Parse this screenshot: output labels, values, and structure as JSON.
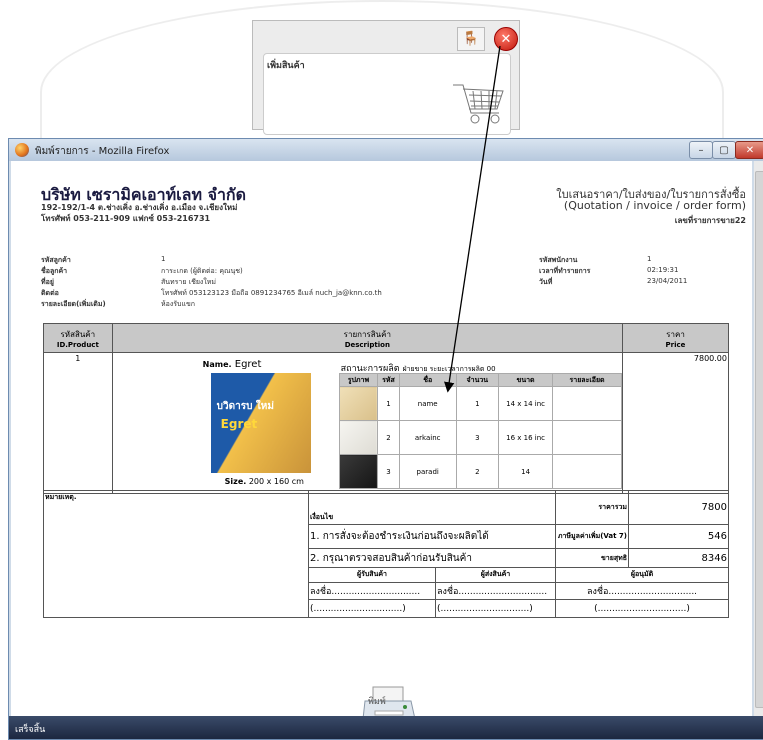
{
  "popup": {
    "title": "เพิ่มสินค้า",
    "close_label": "✕"
  },
  "window": {
    "title": "พิมพ์รายการ - Mozilla Firefox",
    "status": "เสร็จสิ้น",
    "min_label": "–",
    "max_label": "▢",
    "close_label": "✕"
  },
  "company": {
    "name": "บริษัท เซรามิคเอาท์เลท จำกัด",
    "address": "192-192/1-4 ต.ช่างเคิ่ง อ.ช่างเคิ่ง อ.เมือง จ.เชียงใหม่",
    "tel": "โทรศัพท์ 053-211-909 แฟกซ์ 053-216731"
  },
  "document": {
    "title": "ใบเสนอราคา/ใบส่งของ/ใบรายการสั่งซื้อ",
    "subtitle": "(Quotation / invoice / order form)",
    "number_label": "เลขที่รายการขาย22"
  },
  "customer": [
    {
      "label": "รหัสลูกค้า",
      "value": "1"
    },
    {
      "label": "ชื่อลูกค้า",
      "value": "การะเกด (ผู้ติดต่อ: คุณนุช)"
    },
    {
      "label": "ที่อยู่",
      "value": "สันทราย เชียงใหม่"
    },
    {
      "label": "ติดต่อ",
      "value": "โทรศัพท์  053123123  มือถือ  0891234765  อีเมล์  nuch_ja@knn.co.th"
    },
    {
      "label": "รายละเอียด(เพิ่มเติม)",
      "value": "ห้องรับแขก"
    }
  ],
  "order_info": [
    {
      "label": "รหัสพนักงาน",
      "value": "1"
    },
    {
      "label": "เวลาที่ทำรายการ",
      "value": "02:19:31"
    },
    {
      "label": "วันที่",
      "value": "23/04/2011"
    }
  ],
  "table_header": {
    "id_th": "รหัสสินค้า",
    "id_en": "ID.Product",
    "desc_th": "รายการสินค้า",
    "desc_en": "Description",
    "price_th": "ราคา",
    "price_en": "Price"
  },
  "product": {
    "id": "1",
    "name_label": "Name.",
    "name": "Egret",
    "img_text1": "บวิดารบ ใหม่",
    "img_text2": "Egret",
    "size_label": "Size.",
    "size": "200 x 160 cm",
    "status": "สถานะการผลิต",
    "status_detail": "ฝ่ายขาย ระยะเวลาการผลิต 00",
    "price": "7800.00"
  },
  "pattern_headers": [
    "รูปภาพ",
    "รหัส",
    "ชื่อ",
    "จำนวน",
    "ขนาด",
    "รายละเอียด"
  ],
  "patterns": [
    {
      "code": "1",
      "name": "name",
      "qty": "1",
      "size": "14 x 14 inc",
      "detail": "",
      "color": "#e6d3a6"
    },
    {
      "code": "2",
      "name": "arkainc",
      "qty": "3",
      "size": "16 x 16 inc",
      "detail": "",
      "color": "#ecebe6"
    },
    {
      "code": "3",
      "name": "paradi",
      "qty": "2",
      "size": "14",
      "detail": "",
      "color": "#2a2a2a"
    }
  ],
  "footer": {
    "note_label": "หมายเหตุ.",
    "cond_label": "เงื่อนไข",
    "cond1": "1. การสั่งจะต้องชำระเงินก่อนถึงจะผลิตได้",
    "cond2": "2. กรุณาตรวจสอบสินค้าก่อนรับสินค้า",
    "subtotal_label": "ราคารวม",
    "subtotal": "7800",
    "vat_label": "ภาษีมูลค่าเพิ่ม(Vat 7)",
    "vat": "546",
    "net_label": "ขายสุทธิ",
    "net": "8346",
    "sign": [
      {
        "title": "ผู้รับสินค้า",
        "line": "ลงชื่อ...............................",
        "paren": "(...............................)"
      },
      {
        "title": "ผู้ส่งสินค้า",
        "line": "ลงชื่อ...............................",
        "paren": "(...............................)"
      },
      {
        "title": "ผู้อนุมัติ",
        "line": "ลงชื่อ...............................",
        "paren": "(...............................)"
      }
    ]
  },
  "print_label": "พิมพ์",
  "icons": {
    "firefox": "firefox-icon",
    "close": "close-icon",
    "printer": "printer-icon",
    "cart": "shopping-cart-icon",
    "arrow": "annotation-arrow"
  }
}
